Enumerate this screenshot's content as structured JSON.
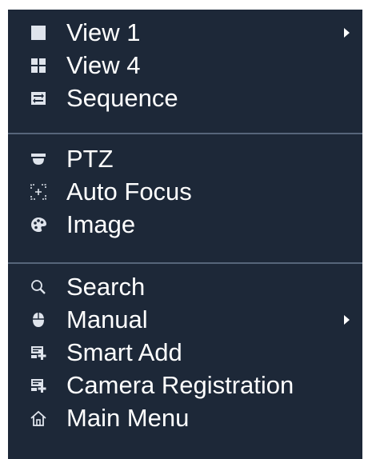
{
  "menu": {
    "items": [
      {
        "label": "View 1",
        "icon": "single-view-icon",
        "has_submenu": true
      },
      {
        "label": "View 4",
        "icon": "quad-view-icon",
        "has_submenu": false
      },
      {
        "label": "Sequence",
        "icon": "sequence-icon",
        "has_submenu": false
      },
      {
        "label": "PTZ",
        "icon": "ptz-camera-icon",
        "has_submenu": false
      },
      {
        "label": "Auto Focus",
        "icon": "focus-icon",
        "has_submenu": false
      },
      {
        "label": "Image",
        "icon": "palette-icon",
        "has_submenu": false
      },
      {
        "label": "Search",
        "icon": "search-icon",
        "has_submenu": false
      },
      {
        "label": "Manual",
        "icon": "mouse-icon",
        "has_submenu": true
      },
      {
        "label": "Smart Add",
        "icon": "add-device-icon",
        "has_submenu": false
      },
      {
        "label": "Camera Registration",
        "icon": "camera-registration-icon",
        "has_submenu": false
      },
      {
        "label": "Main Menu",
        "icon": "home-icon",
        "has_submenu": false
      }
    ]
  },
  "colors": {
    "background": "#1d2838",
    "text": "#ffffff",
    "divider": "#56657a"
  }
}
